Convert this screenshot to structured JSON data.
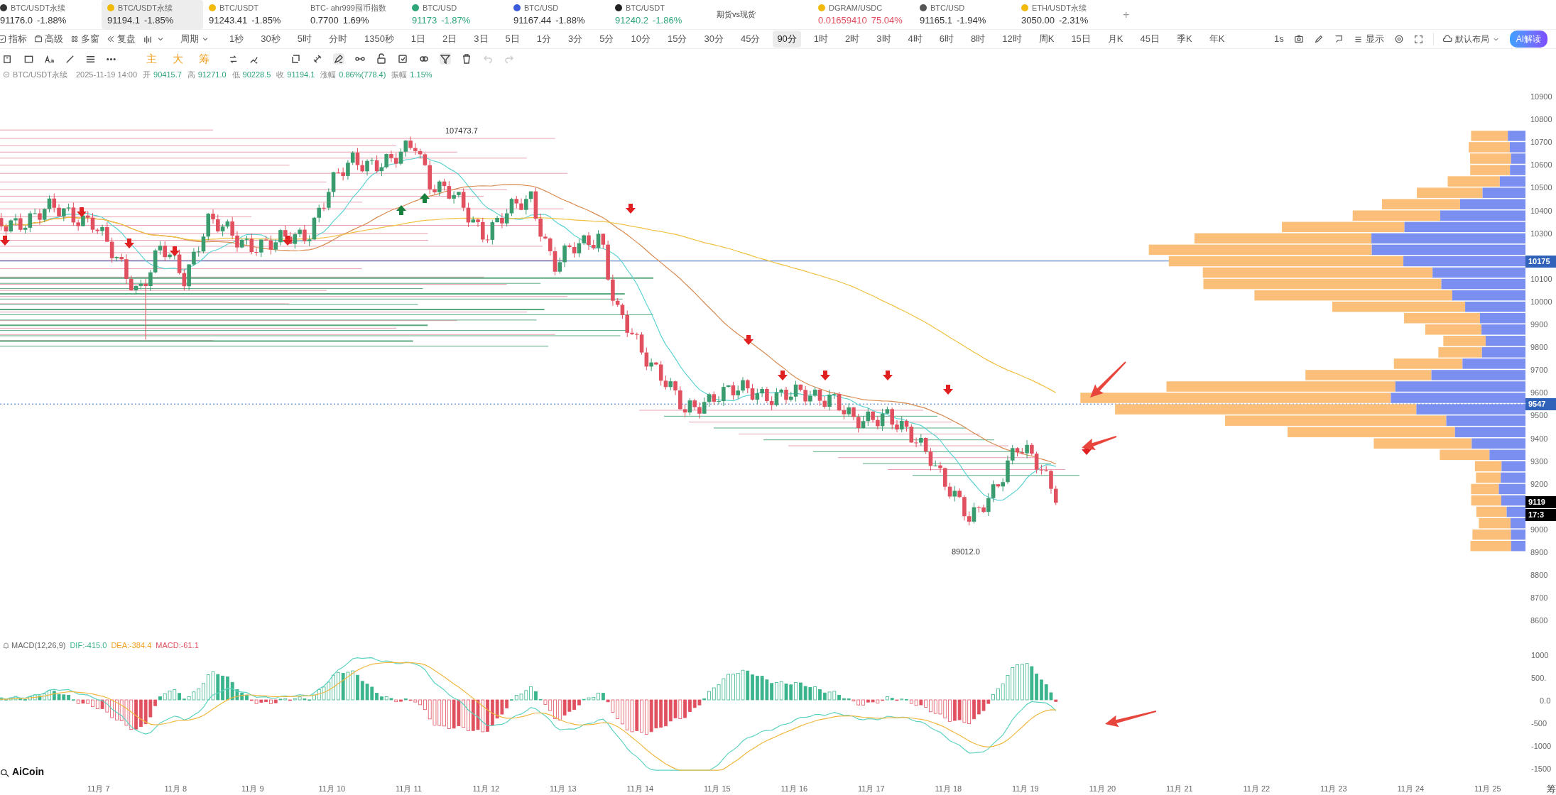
{
  "tabs": [
    {
      "pair": "BTC/USDT永续",
      "quote": {
        "price": "91176.0",
        "change": "-1.88%",
        "color": "#333333"
      },
      "color": "#333333",
      "selected": false
    },
    {
      "pair": "BTC/USDT永续",
      "quote": {
        "price": "91194.1",
        "change": "-1.85%",
        "color": "#333333"
      },
      "color": "#f0b90b",
      "selected": true
    },
    {
      "pair": "BTC/USDT",
      "quote": {
        "price": "91243.41",
        "change": "-1.85%",
        "color": "#333333"
      },
      "color": "#f0b90b",
      "selected": false
    },
    {
      "pair": "BTC- ahr999囤币指数",
      "quote": {
        "price": "0.7700",
        "change": "1.69%",
        "color": "#333333"
      },
      "selected": false
    },
    {
      "pair": "BTC/USD",
      "quote": {
        "price": "91173",
        "change": "-1.87%",
        "color": "#2fa57a"
      },
      "color": "#2fa57a",
      "selected": false
    },
    {
      "pair": "BTC/USD",
      "quote": {
        "price": "91167.44",
        "change": "-1.88%",
        "color": "#333333"
      },
      "color": "#3b5bdb",
      "selected": false
    },
    {
      "pair": "BTC/USDT",
      "quote": {
        "price": "91240.2",
        "change": "-1.86%",
        "color": "#2fa57a"
      },
      "color": "#222222",
      "selected": false
    },
    {
      "pair": "期货vs现货",
      "selected": false
    },
    {
      "pair": "DGRAM/USDC",
      "quote": {
        "price": "0.01659410",
        "change": "75.04%",
        "color": "#e0505f"
      },
      "color": "#f0b90b",
      "selected": false
    },
    {
      "pair": "BTC/USD",
      "quote": {
        "price": "91165.1",
        "change": "-1.94%",
        "color": "#333333"
      },
      "color": "#555555",
      "selected": false
    },
    {
      "pair": "ETH/USDT永续",
      "quote": {
        "price": "3050.00",
        "change": "-2.31%",
        "color": "#333333"
      },
      "color": "#f0b90b",
      "selected": false
    }
  ],
  "add_tab": "+",
  "toolbar": {
    "left": [
      {
        "label": "指标",
        "kind": "check"
      },
      {
        "label": "高级",
        "kind": "box"
      },
      {
        "label": "多窗",
        "kind": "grid"
      },
      {
        "label": "复盘",
        "kind": "rewind"
      },
      {
        "kind": "chart-type"
      },
      {
        "label": "周期",
        "kind": "caret"
      }
    ],
    "intervals": [
      {
        "label": "1秒",
        "selected": false
      },
      {
        "label": "30秒",
        "selected": false
      },
      {
        "label": "5时",
        "selected": false
      },
      {
        "label": "分时",
        "selected": false
      },
      {
        "label": "1350秒",
        "selected": false
      },
      {
        "label": "1日",
        "selected": false
      },
      {
        "label": "2日",
        "selected": false
      },
      {
        "label": "3日",
        "selected": false
      },
      {
        "label": "5日",
        "selected": false
      },
      {
        "label": "1分",
        "selected": false
      },
      {
        "label": "3分",
        "selected": false
      },
      {
        "label": "5分",
        "selected": false
      },
      {
        "label": "10分",
        "selected": false
      },
      {
        "label": "15分",
        "selected": false
      },
      {
        "label": "30分",
        "selected": false
      },
      {
        "label": "45分",
        "selected": false
      },
      {
        "label": "90分",
        "selected": true
      },
      {
        "label": "1时",
        "selected": false
      },
      {
        "label": "2时",
        "selected": false
      },
      {
        "label": "3时",
        "selected": false
      },
      {
        "label": "4时",
        "selected": false
      },
      {
        "label": "6时",
        "selected": false
      },
      {
        "label": "8时",
        "selected": false
      },
      {
        "label": "12时",
        "selected": false
      },
      {
        "label": "周K",
        "selected": false
      },
      {
        "label": "15日",
        "selected": false
      },
      {
        "label": "月K",
        "selected": false
      },
      {
        "label": "45日",
        "selected": false
      },
      {
        "label": "季K",
        "selected": false
      },
      {
        "label": "年K",
        "selected": false
      }
    ],
    "right": {
      "speed": "1s",
      "display": "显示",
      "layout": "默认布局",
      "ai": "AI解读"
    }
  },
  "drawing_tools": {
    "chars": [
      "主",
      "大",
      "筹"
    ]
  },
  "info": {
    "symbol": "BTC/USDT永续",
    "time": "2025-11-19 14:00",
    "fields": [
      {
        "label": "开",
        "value": "90415.7"
      },
      {
        "label": "高",
        "value": "91271.0"
      },
      {
        "label": "低",
        "value": "90228.5"
      },
      {
        "label": "收",
        "value": "91194.1"
      },
      {
        "label": "涨幅",
        "value": "0.86%(778.4)"
      },
      {
        "label": "振幅",
        "value": "1.15%"
      }
    ]
  },
  "chart": {
    "high_label": "107473.7",
    "low_label": "89012.0"
  },
  "price_axis": {
    "labels": [
      "10900",
      "10800",
      "10700",
      "10600",
      "10500",
      "10400",
      "10300",
      "10100",
      "10000",
      "9900",
      "9800",
      "9700",
      "9600",
      "9500",
      "9400",
      "9300",
      "9200",
      "9000",
      "8900",
      "8800",
      "8700",
      "8600"
    ],
    "markers": [
      {
        "text": "10175",
        "kind": "level"
      },
      {
        "text": "9547",
        "kind": "level"
      },
      {
        "text": "9119",
        "kind": "last"
      },
      {
        "text": "17:3",
        "kind": "last"
      }
    ]
  },
  "macd": {
    "title": "MACD(12,26,9)",
    "dif": "DIF:-415.0",
    "dea": "DEA:-384.4",
    "macd": "MACD:-61.1",
    "axis": [
      "1000",
      "500.",
      "0.0",
      "-500",
      "-1000",
      "-1500"
    ]
  },
  "date_axis": [
    "11月 7",
    "11月 8",
    "11月 9",
    "11月 10",
    "11月 11",
    "11月 12",
    "11月 13",
    "11月 14",
    "11月 15",
    "11月 16",
    "11月 17",
    "11月 18",
    "11月 19",
    "11月 20",
    "11月 21",
    "11月 22",
    "11月 23",
    "11月 24",
    "11月 25"
  ],
  "corner_label": "筹",
  "logo": "AiCoin"
}
